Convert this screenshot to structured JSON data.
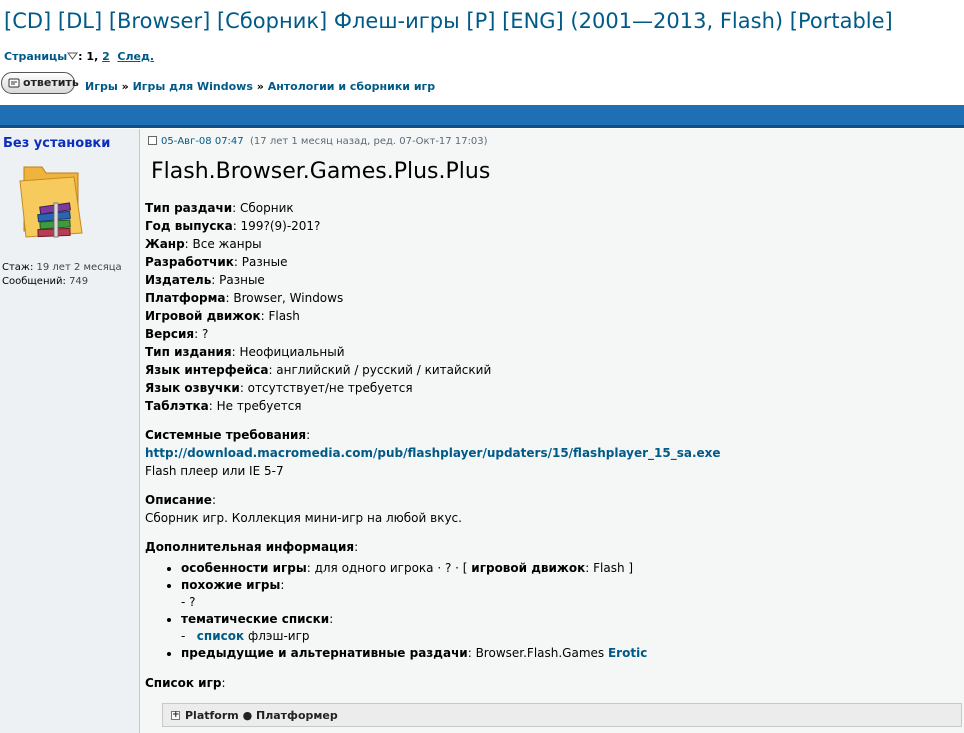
{
  "topic": {
    "title": "[CD] [DL] [Browser] [Сборник] Флеш-игры [P] [ENG] (2001—2013, Flash) [Portable]"
  },
  "pagination": {
    "label": "Страницы",
    "current": "1",
    "sep": ",",
    "page2": "2",
    "next": "След."
  },
  "toolbar": {
    "reply_label": "ответить"
  },
  "breadcrumbs": [
    {
      "label": "Игры"
    },
    {
      "label": "Игры для Windows"
    },
    {
      "label": "Антологии и сборники игр"
    }
  ],
  "breadcrumb_sep": "»",
  "user": {
    "nick": "Без установки",
    "stazh_label": "Стаж:",
    "stazh_value": "19 лет 2 месяца",
    "posts_label": "Сообщений:",
    "posts_value": "749"
  },
  "post": {
    "date": "05-Авг-08 07:47",
    "meta": "(17 лет 1 месяц назад, ред. 07-Окт-17 17:03)",
    "title": "Flash.Browser.Games.Plus.Plus",
    "fields": [
      {
        "label": "Тип раздачи",
        "value": "Сборник"
      },
      {
        "label": "Год выпуска",
        "value": "199?(9)-201?"
      },
      {
        "label": "Жанр",
        "value": "Все жанры"
      },
      {
        "label": "Разработчик",
        "value": "Разные"
      },
      {
        "label": "Издатель",
        "value": "Разные"
      },
      {
        "label": "Платформа",
        "value": "Browser, Windows"
      },
      {
        "label": "Игровой движок",
        "value": "Flash"
      },
      {
        "label": "Версия",
        "value": "?"
      },
      {
        "label": "Тип издания",
        "value": "Неофициальный"
      },
      {
        "label": "Язык интерфейса",
        "value": "английский / русский / китайский"
      },
      {
        "label": "Язык озвучки",
        "value": "отсутствует/не требуется"
      },
      {
        "label": "Таблэтка",
        "value": "Не требуется"
      }
    ],
    "sysreq_label": "Системные требования",
    "sysreq_link": "http://download.macromedia.com/pub/flashplayer/updaters/15/flashplayer_15_sa.exe",
    "sysreq_text": "Flash плеер или IE 5-7",
    "desc_label": "Описание",
    "desc_text": "Сборник игр. Коллекция мини-игр на любой вкус.",
    "extra_label": "Дополнительная информация",
    "extra": {
      "features_label": "особенности игры",
      "features_pre": "для одного игрока · ? · [",
      "features_engine_label": "игровой движок",
      "features_engine_value": "Flash ]",
      "similar_label": "похожие игры",
      "similar_value": "- ?",
      "thematic_label": "тематические списки",
      "thematic_dash": "-",
      "thematic_link": "список",
      "thematic_text": "флэш-игр",
      "prev_label": "предыдущие и альтернативные раздачи",
      "prev_text": "Browser.Flash.Games",
      "prev_link": "Erotic"
    },
    "gamelist_label": "Список игр",
    "spoiler": "Platform ● Платформер"
  },
  "colors": {
    "link": "#005a88",
    "nick": "#0b2ebd",
    "header_bar": "#1f6fb5",
    "sidebar_bg": "#eef1f4",
    "post_bg": "#f5f6f6"
  }
}
